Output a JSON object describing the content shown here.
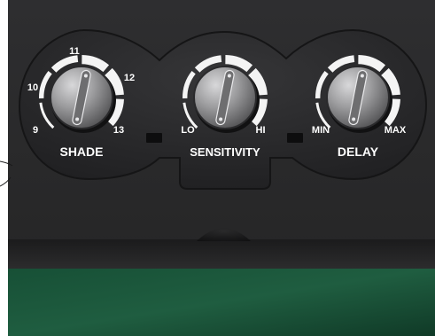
{
  "knobs": [
    {
      "id": "shade",
      "label": "SHADE",
      "scale": [
        "9",
        "10",
        "11",
        "12",
        "13"
      ],
      "segments": 6,
      "level": 0.55
    },
    {
      "id": "sensitivity",
      "label": "SENSITIVITY",
      "scale": [
        "LO",
        "HI"
      ],
      "segments": 6,
      "level": 0.55
    },
    {
      "id": "delay",
      "label": "DELAY",
      "scale": [
        "MIN",
        "MAX"
      ],
      "segments": 6,
      "level": 0.55
    }
  ],
  "colors": {
    "panel_dark": "#252527",
    "panel_mid": "#2f2f31",
    "knob_light": "#9a9a9c",
    "visor_green": "#1d5a3c",
    "label_white": "#ffffff"
  }
}
